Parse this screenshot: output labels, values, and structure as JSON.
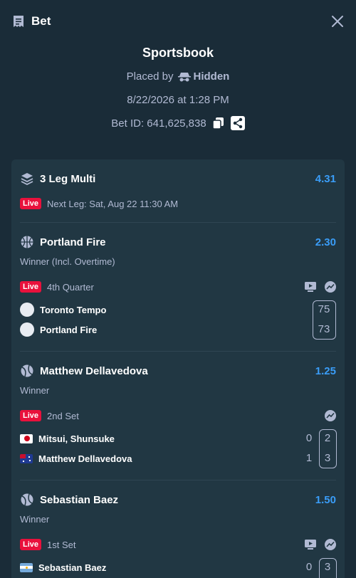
{
  "header": {
    "title": "Bet"
  },
  "summary": {
    "sportsbook": "Sportsbook",
    "placed_by_label": "Placed by",
    "placed_by_user": "Hidden",
    "datetime": "8/22/2026 at 1:28 PM",
    "bet_id": "Bet ID: 641,625,838"
  },
  "multi": {
    "title": "3 Leg Multi",
    "odds": "4.31",
    "live": "Live",
    "next_leg": "Next Leg: Sat, Aug 22 11:30 AM"
  },
  "legs": [
    {
      "name": "Portland Fire",
      "odds": "2.30",
      "market": "Winner (Incl. Overtime)",
      "live": "Live",
      "period": "4th Quarter",
      "teams": [
        {
          "name": "Toronto Tempo",
          "score": "75"
        },
        {
          "name": "Portland Fire",
          "score": "73"
        }
      ]
    },
    {
      "name": "Matthew Dellavedova",
      "odds": "1.25",
      "market": "Winner",
      "live": "Live",
      "period": "2nd Set",
      "teams": [
        {
          "name": "Mitsui, Shunsuke",
          "sets": "0",
          "games": "2"
        },
        {
          "name": "Matthew Dellavedova",
          "sets": "1",
          "games": "3"
        }
      ]
    },
    {
      "name": "Sebastian Baez",
      "odds": "1.50",
      "market": "Winner",
      "live": "Live",
      "period": "1st Set",
      "teams": [
        {
          "name": "Sebastian Baez",
          "sets": "0",
          "games": "3"
        }
      ]
    }
  ],
  "colors": {
    "background": "#1a2c38",
    "card": "#213743",
    "accent": "#3a9df8",
    "live": "#e9113c"
  }
}
